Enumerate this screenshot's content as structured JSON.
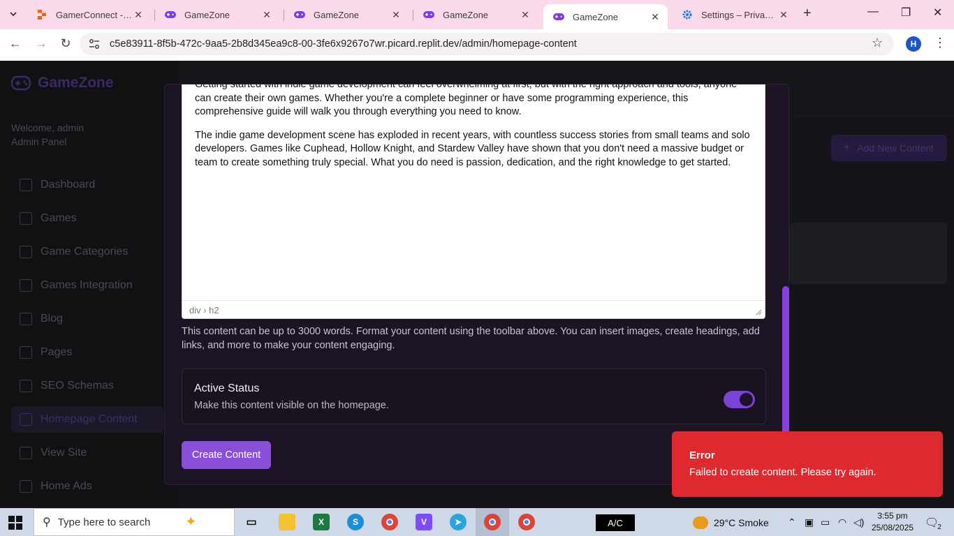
{
  "browser": {
    "tabs": [
      {
        "title": "GamerConnect - Repl",
        "icon": "replit-icon",
        "active": false
      },
      {
        "title": "GameZone",
        "icon": "gamepad-icon",
        "active": false
      },
      {
        "title": "GameZone",
        "icon": "gamepad-icon",
        "active": false
      },
      {
        "title": "GameZone",
        "icon": "gamepad-icon",
        "active": false
      },
      {
        "title": "GameZone",
        "icon": "gamepad-icon",
        "active": true
      },
      {
        "title": "Settings – Privacy and",
        "icon": "gear-icon",
        "active": false
      }
    ],
    "url": "c5e83911-8f5b-472c-9aa5-2b8d345ea9c8-00-3fe6x9267o7wr.picard.replit.dev/admin/homepage-content",
    "profile_initial": "H"
  },
  "sidebar": {
    "brand": "GameZone",
    "welcome_line1": "Welcome, admin",
    "welcome_line2": "Admin Panel",
    "items": [
      {
        "label": "Dashboard",
        "active": false
      },
      {
        "label": "Games",
        "active": false
      },
      {
        "label": "Game Categories",
        "active": false
      },
      {
        "label": "Games Integration",
        "active": false
      },
      {
        "label": "Blog",
        "active": false
      },
      {
        "label": "Pages",
        "active": false
      },
      {
        "label": "SEO Schemas",
        "active": false
      },
      {
        "label": "Homepage Content",
        "active": true
      },
      {
        "label": "View Site",
        "active": false
      },
      {
        "label": "Home Ads",
        "active": false
      }
    ]
  },
  "main": {
    "add_new_label": "Add New Content"
  },
  "modal": {
    "editor_paragraphs": [
      "Getting started with indie game development can feel overwhelming at first, but with the right approach and tools, anyone can create their own games. Whether you're a complete beginner or have some programming experience, this comprehensive guide will walk you through everything you need to know.",
      "The indie game development scene has exploded in recent years, with countless success stories from small teams and solo developers. Games like Cuphead, Hollow Knight, and Stardew Valley have shown that you don't need a massive budget or team to create something truly special. What you do need is passion, dedication, and the right knowledge to get started."
    ],
    "editor_path": "div › h2",
    "help_text": "This content can be up to 3000 words. Format your content using the toolbar above. You can insert images, create headings, add links, and more to make your content engaging.",
    "active_status": {
      "title": "Active Status",
      "description": "Make this content visible on the homepage.",
      "enabled": true
    },
    "submit_label": "Create Content"
  },
  "toast": {
    "title": "Error",
    "message": "Failed to create content. Please try again.",
    "color": "#e0292e"
  },
  "taskbar": {
    "search_placeholder": "Type here to search",
    "ac_label": "A/C",
    "weather": "29°C  Smoke",
    "time": "3:55 pm",
    "date": "25/08/2025",
    "notification_count": "2"
  }
}
